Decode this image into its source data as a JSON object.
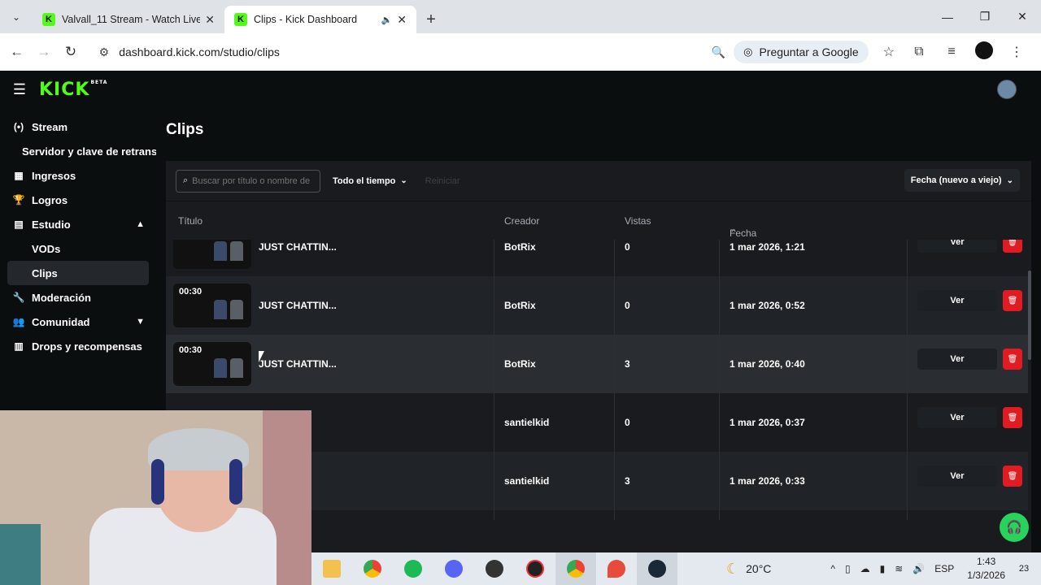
{
  "browser": {
    "tabs": [
      {
        "title": "Valvall_11 Stream - Watch Live o",
        "active": false
      },
      {
        "title": "Clips - Kick Dashboard",
        "active": true
      }
    ],
    "url": "dashboard.kick.com/studio/clips",
    "ask_google": "Preguntar a Google"
  },
  "header": {
    "logo": "KICK",
    "logo_badge": "BETA"
  },
  "sidebar": {
    "items": [
      {
        "label": "Stream",
        "icon": "broadcast-icon"
      },
      {
        "label": "Servidor y clave de retransmisión",
        "icon": ""
      },
      {
        "label": "Ingresos",
        "icon": "chart-icon"
      },
      {
        "label": "Logros",
        "icon": "trophy-icon"
      },
      {
        "label": "Estudio",
        "icon": "studio-icon"
      },
      {
        "label": "VODs",
        "icon": ""
      },
      {
        "label": "Clips",
        "icon": ""
      },
      {
        "label": "Moderación",
        "icon": "wrench-icon"
      },
      {
        "label": "Comunidad",
        "icon": "users-icon"
      },
      {
        "label": "Drops y recompensas",
        "icon": "gift-icon"
      }
    ]
  },
  "page": {
    "title": "Clips",
    "search_placeholder": "Buscar por título o nombre de",
    "time_filter": "Todo el tiempo",
    "reset": "Reiniciar",
    "sort": "Fecha (nuevo a viejo)",
    "columns": {
      "title": "Título",
      "creator": "Creador",
      "views": "Vistas",
      "date": "Fecha"
    },
    "view_label": "Ver",
    "rows": [
      {
        "duration": "",
        "title": "JUST CHATTIN...",
        "creator": "BotRix",
        "views": "0",
        "date": "1 mar 2026, 1:21"
      },
      {
        "duration": "00:30",
        "title": "JUST CHATTIN...",
        "creator": "BotRix",
        "views": "0",
        "date": "1 mar 2026, 0:52"
      },
      {
        "duration": "00:30",
        "title": "JUST CHATTIN...",
        "creator": "BotRix",
        "views": "3",
        "date": "1 mar 2026, 0:40"
      },
      {
        "duration": "",
        "title": "",
        "creator": "santielkid",
        "views": "0",
        "date": "1 mar 2026, 0:37"
      },
      {
        "duration": "",
        "title": "",
        "creator": "santielkid",
        "views": "3",
        "date": "1 mar 2026, 0:33"
      }
    ]
  },
  "taskbar": {
    "temperature": "20°C",
    "lang": "ESP",
    "time": "1:43",
    "date": "1/3/2026",
    "notifications": "23"
  },
  "colors": {
    "brand": "#53fc18",
    "danger": "#e11b22",
    "bg": "#0b0e0f",
    "panel": "#191b1f"
  }
}
